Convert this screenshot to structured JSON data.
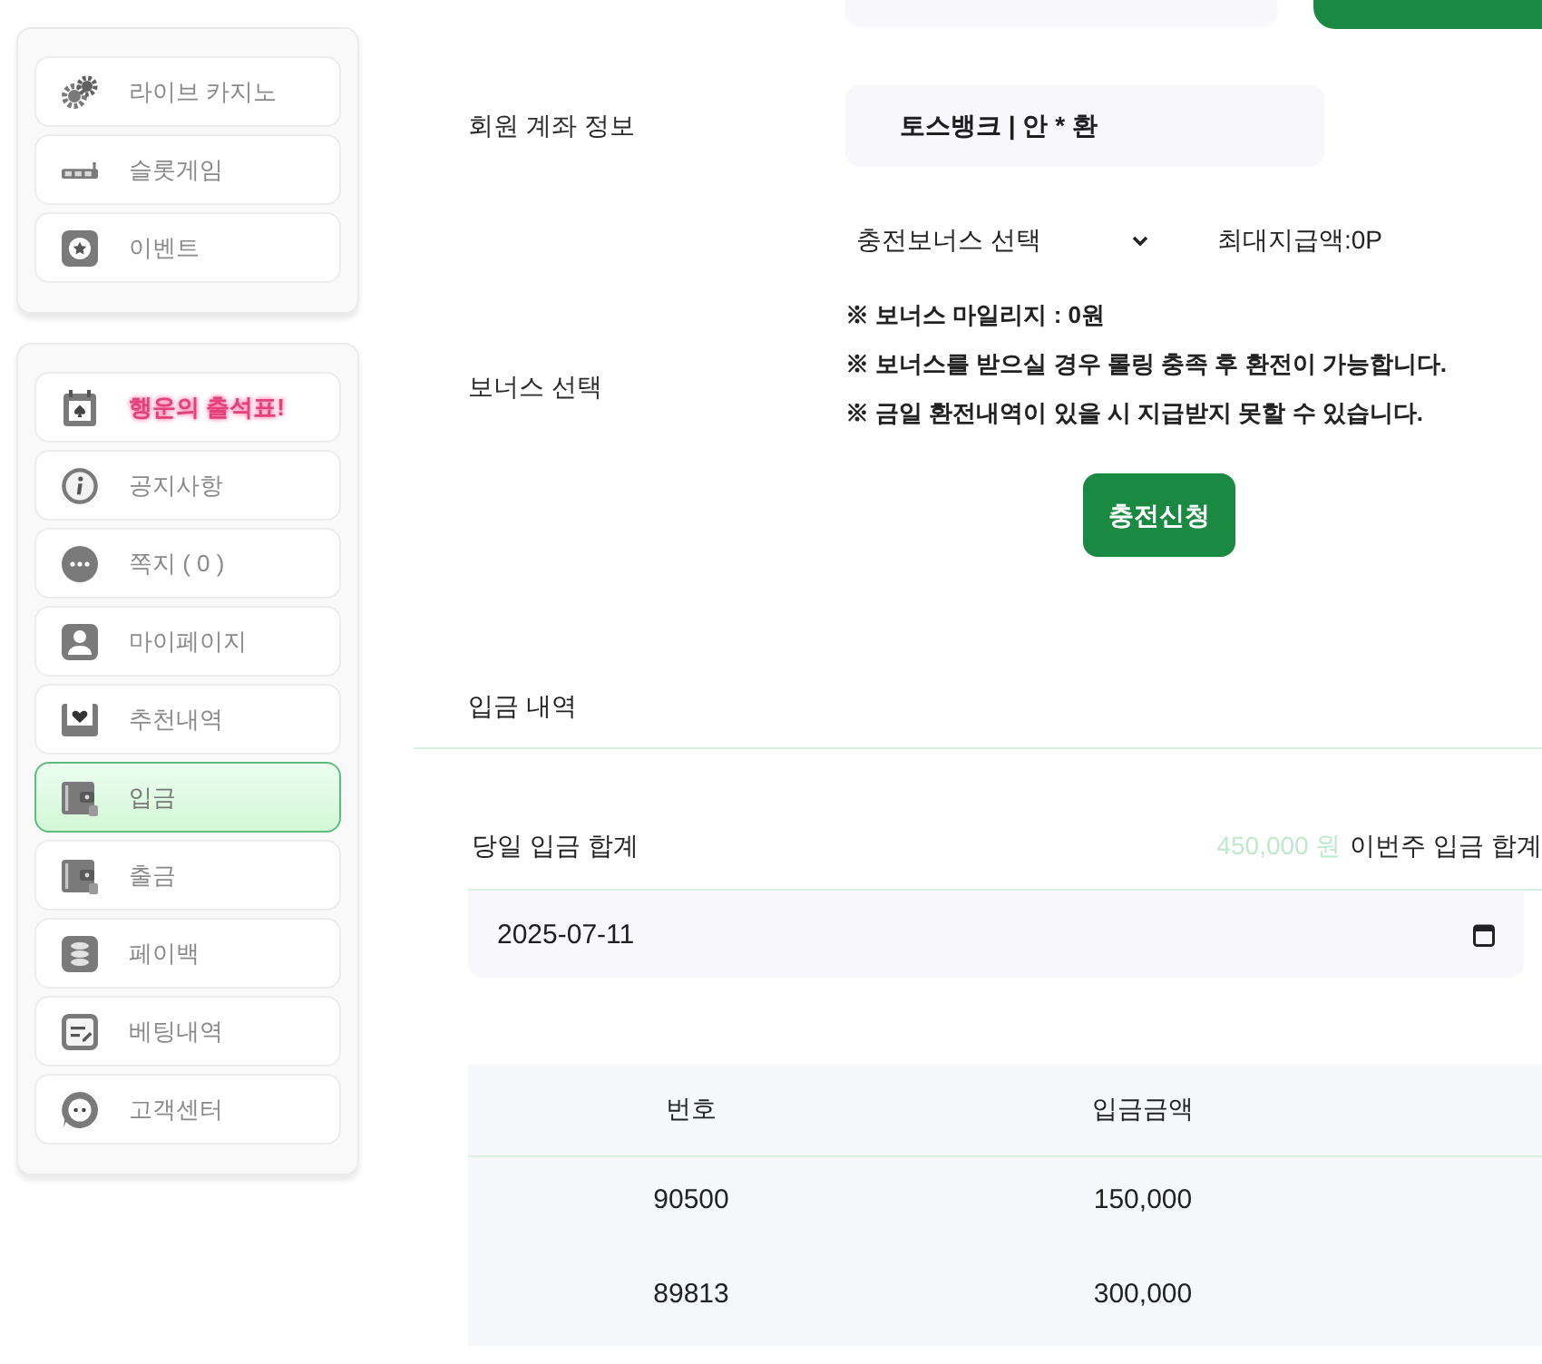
{
  "sidebar": {
    "groups": [
      {
        "items": [
          {
            "label": "라이브 카지노",
            "selected": false,
            "highlighted": false
          },
          {
            "label": "슬롯게임",
            "selected": false,
            "highlighted": false
          },
          {
            "label": "이벤트",
            "selected": false,
            "highlighted": false
          }
        ]
      },
      {
        "items": [
          {
            "label": "행운의 출석표!",
            "selected": false,
            "highlighted": true
          },
          {
            "label": "공지사항",
            "selected": false,
            "highlighted": false
          },
          {
            "label": "쪽지 ( 0 )",
            "selected": false,
            "highlighted": false
          },
          {
            "label": "마이페이지",
            "selected": false,
            "highlighted": false
          },
          {
            "label": "추천내역",
            "selected": false,
            "highlighted": false
          },
          {
            "label": "입금",
            "selected": true,
            "highlighted": false
          },
          {
            "label": "출금",
            "selected": false,
            "highlighted": false
          },
          {
            "label": "페이백",
            "selected": false,
            "highlighted": false
          },
          {
            "label": "베팅내역",
            "selected": false,
            "highlighted": false
          },
          {
            "label": "고객센터",
            "selected": false,
            "highlighted": false
          }
        ]
      }
    ]
  },
  "account": {
    "label": "회원 계좌 정보",
    "value": "토스뱅크 | 안 * 환"
  },
  "bonus": {
    "label": "보너스 선택",
    "select": {
      "value": "충전보너스 선택"
    },
    "max_payout": "최대지급액:0P",
    "notes": [
      "※ 보너스 마일리지 : 0원",
      "※ 보너스를 받으실 경우 롤링 충족 후 환전이 가능합니다.",
      "※ 금일 환전내역이 있을 시 지급받지 못할 수 있습니다."
    ],
    "submit_button": "충전신청"
  },
  "deposit_history": {
    "title": "입금 내역",
    "today_total_label": "당일 입금 합계",
    "today_total": "450,000 원",
    "week_total_label": "이번주 입금 합계",
    "date_field": {
      "value": "2025-07-11"
    },
    "table": {
      "columns": [
        "번호",
        "입금금액"
      ],
      "rows": [
        [
          "90500",
          "150,000"
        ],
        [
          "89813",
          "300,000"
        ]
      ]
    }
  }
}
